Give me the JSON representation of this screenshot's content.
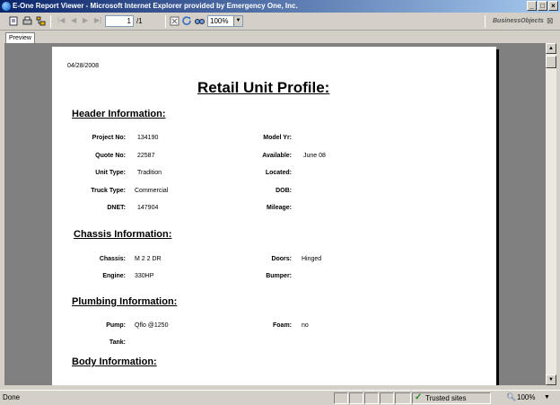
{
  "window": {
    "title": "E-One Report Viewer - Microsoft Internet Explorer provided by Emergency One, Inc."
  },
  "toolbar": {
    "page_current": "1",
    "page_total": "/1",
    "zoom": "100%",
    "brand": "BusinessObjects"
  },
  "tabs": [
    {
      "label": "Preview"
    }
  ],
  "report": {
    "date": "04/28/2008",
    "title": "Retail Unit Profile:",
    "sections": {
      "header": "Header Information:",
      "chassis": "Chassis Information:",
      "plumbing": "Plumbing Information:",
      "body": "Body Information:"
    },
    "fields": {
      "project_no": {
        "label": "Project No:",
        "value": "134190"
      },
      "quote_no": {
        "label": "Quote No:",
        "value": "22587"
      },
      "unit_type": {
        "label": "Unit Type:",
        "value": "Tradition"
      },
      "truck_type": {
        "label": "Truck Type:",
        "value": "Commercial"
      },
      "dnet": {
        "label": "DNET:",
        "value": "147904"
      },
      "model_yr": {
        "label": "Model Yr:",
        "value": ""
      },
      "available": {
        "label": "Available:",
        "value": "June 08"
      },
      "located": {
        "label": "Located:",
        "value": ""
      },
      "dob": {
        "label": "DOB:",
        "value": ""
      },
      "mileage": {
        "label": "Mileage:",
        "value": ""
      },
      "chassis": {
        "label": "Chassis:",
        "value": "M 2 2 DR"
      },
      "engine": {
        "label": "Engine:",
        "value": "330HP"
      },
      "doors": {
        "label": "Doors:",
        "value": "Hinged"
      },
      "bumper": {
        "label": "Bumper:",
        "value": ""
      },
      "pump": {
        "label": "Pump:",
        "value": "Qflo @1250"
      },
      "tank": {
        "label": "Tank:",
        "value": ""
      },
      "foam": {
        "label": "Foam:",
        "value": "no"
      }
    }
  },
  "status": {
    "text": "Done",
    "zone": "Trusted sites",
    "zoom": "100%"
  }
}
